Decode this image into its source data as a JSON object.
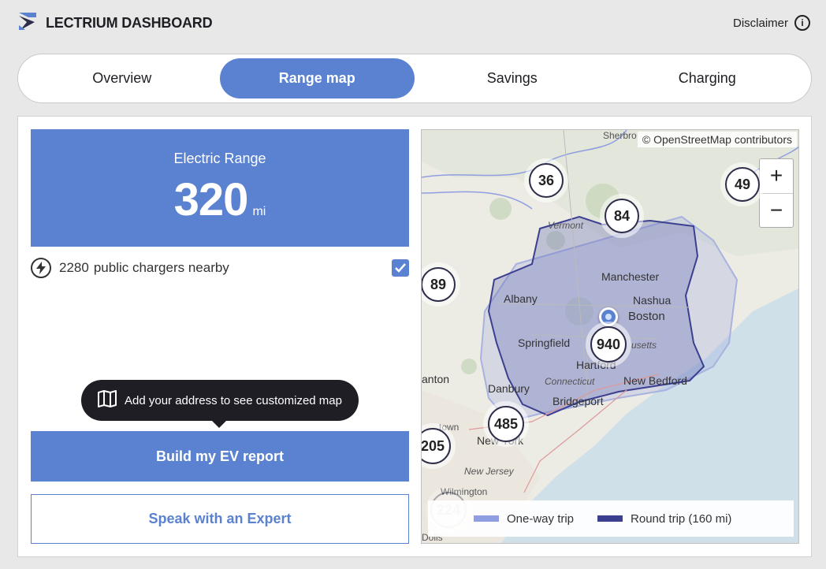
{
  "header": {
    "brand": "LECTRIUM DASHBOARD",
    "disclaimer": "Disclaimer"
  },
  "tabs": [
    {
      "label": "Overview",
      "active": false
    },
    {
      "label": "Range map",
      "active": true
    },
    {
      "label": "Savings",
      "active": false
    },
    {
      "label": "Charging",
      "active": false
    }
  ],
  "range": {
    "label": "Electric Range",
    "value": "320",
    "unit": "mi"
  },
  "chargers": {
    "count": "2280",
    "text": "public chargers nearby",
    "checked": true
  },
  "tooltip": "Add your address to see customized map",
  "buttons": {
    "build": "Build my EV report",
    "expert": "Speak with an Expert"
  },
  "map": {
    "attribution": "© OpenStreetMap contributors",
    "zoom_in": "+",
    "zoom_out": "−",
    "clusters": [
      "36",
      "84",
      "49",
      "89",
      "940",
      "485",
      "205",
      "224"
    ],
    "places": {
      "sherbrooke": "Sherbro",
      "vermont": "Vermont",
      "manchester": "Manchester",
      "albany": "Albany",
      "nashua": "Nashua",
      "boston": "Boston",
      "springfield": "Springfield",
      "massachusetts": "usetts",
      "hartford": "Hartford",
      "connecticut": "Connecticut",
      "new_bedford": "New Bedford",
      "scranton": "anton",
      "danbury": "Danbury",
      "bridgeport": "Bridgeport",
      "new_york": "New York",
      "allentown": "town",
      "new_jersey": "New Jersey",
      "wilmington": "Wilmington",
      "dover": "Dolls"
    },
    "legend": {
      "one_way": "One-way trip",
      "round_trip": "Round trip (160 mi)",
      "one_way_color": "#8f9ee0",
      "round_trip_color": "#3b3f8f"
    }
  }
}
